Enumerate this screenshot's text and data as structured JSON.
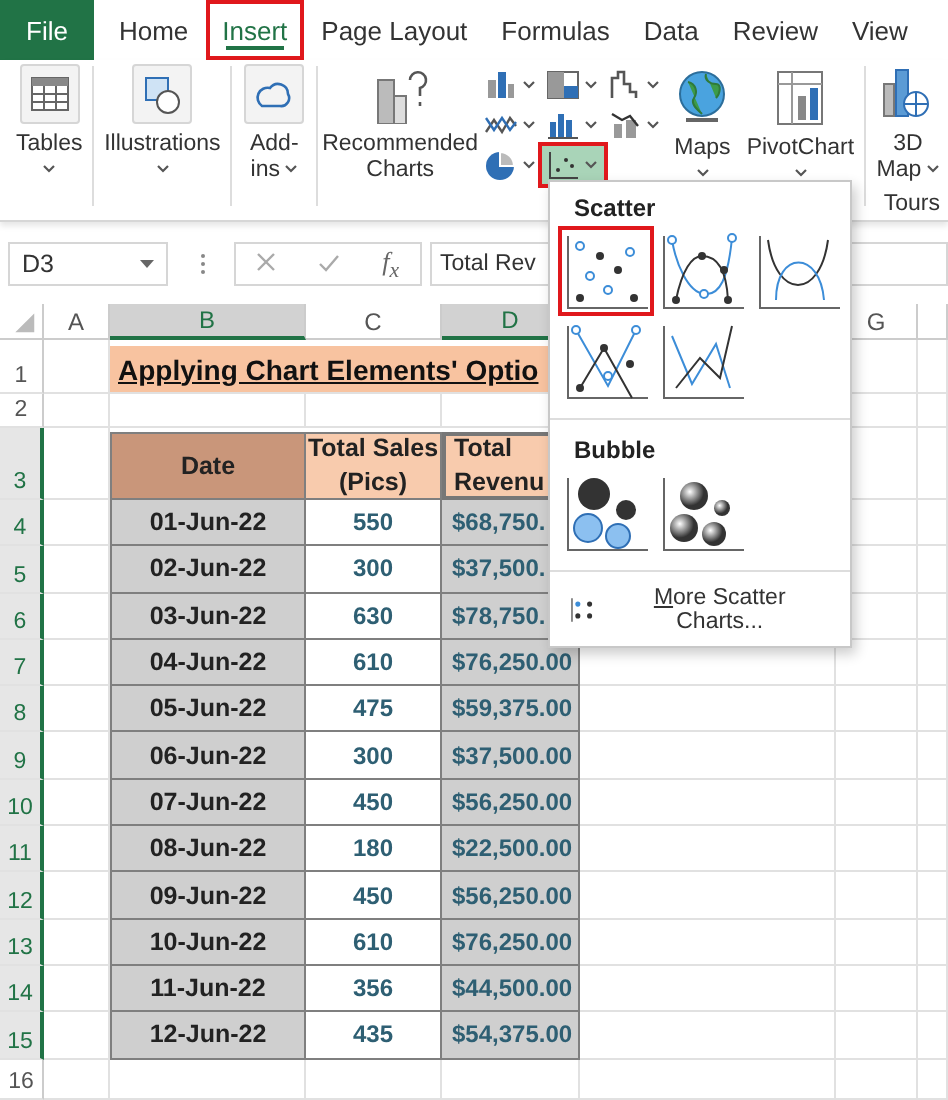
{
  "ribbon_tabs": [
    {
      "label": "File",
      "kind": "file",
      "selected": false,
      "highlighted": false
    },
    {
      "label": "Home",
      "kind": "tab",
      "selected": false,
      "highlighted": false
    },
    {
      "label": "Insert",
      "kind": "tab",
      "selected": true,
      "highlighted": true
    },
    {
      "label": "Page Layout",
      "kind": "tab",
      "selected": false,
      "highlighted": false
    },
    {
      "label": "Formulas",
      "kind": "tab",
      "selected": false,
      "highlighted": false
    },
    {
      "label": "Data",
      "kind": "tab",
      "selected": false,
      "highlighted": false
    },
    {
      "label": "Review",
      "kind": "tab",
      "selected": false,
      "highlighted": false
    },
    {
      "label": "View",
      "kind": "tab",
      "selected": false,
      "highlighted": false
    }
  ],
  "ribbon_buttons": [
    {
      "label": "Tables",
      "kind": "tables",
      "dropdown": true
    },
    {
      "label": "Illustrations",
      "kind": "illustrations",
      "dropdown": true
    },
    {
      "label": "Add-ins",
      "kind": "addins",
      "dropdown": true
    },
    {
      "label": "Recommended Charts",
      "kind": "recommended",
      "dropdown": false
    },
    {
      "kind": "chart_grid"
    },
    {
      "label": "Maps",
      "kind": "maps",
      "dropdown": true
    },
    {
      "label": "PivotChart",
      "kind": "pivot",
      "dropdown": true
    },
    {
      "label": "3D Map",
      "kind": "map3d",
      "dropdown": true
    }
  ],
  "chart_buttons": [
    {
      "kind": "column",
      "selected": false,
      "highlighted": false
    },
    {
      "kind": "hierarchy",
      "selected": false,
      "highlighted": false
    },
    {
      "kind": "waterfall",
      "selected": false,
      "highlighted": false
    },
    {
      "kind": "line",
      "selected": false,
      "highlighted": false
    },
    {
      "kind": "statistic",
      "selected": false,
      "highlighted": false
    },
    {
      "kind": "combo",
      "selected": false,
      "highlighted": false
    },
    {
      "kind": "pie",
      "selected": false,
      "highlighted": false
    },
    {
      "kind": "scatter",
      "selected": true,
      "highlighted": true
    }
  ],
  "group_labels": [
    "Tours"
  ],
  "formula_bar": {
    "name_box": "D3",
    "function_button": "f$_{x}$",
    "value": "Total Rev"
  },
  "columns": [
    {
      "label": "A",
      "selected": false
    },
    {
      "label": "B",
      "selected": true
    },
    {
      "label": "C",
      "selected": false
    },
    {
      "label": "D",
      "selected": true
    },
    {
      "label": "G",
      "selected": false
    }
  ],
  "row_headers": [
    {
      "label": "1",
      "selected": false
    },
    {
      "label": "2",
      "selected": false
    },
    {
      "label": "3",
      "selected": true
    },
    {
      "label": "4",
      "selected": true
    },
    {
      "label": "5",
      "selected": true
    },
    {
      "label": "6",
      "selected": true
    },
    {
      "label": "7",
      "selected": true
    },
    {
      "label": "8",
      "selected": true
    },
    {
      "label": "9",
      "selected": true
    },
    {
      "label": "10",
      "selected": true
    },
    {
      "label": "11",
      "selected": true
    },
    {
      "label": "12",
      "selected": true
    },
    {
      "label": "13",
      "selected": true
    },
    {
      "label": "14",
      "selected": true
    },
    {
      "label": "15",
      "selected": true
    },
    {
      "label": "16",
      "selected": false
    }
  ],
  "sheet": {
    "title": "Applying Chart Elements' Optio",
    "headers": [
      "Date",
      "Total Sales (Pics)",
      "Total Revenu"
    ],
    "rows": [
      {
        "date": "01-Jun-22",
        "sales": "550",
        "revenue": "$68,750."
      },
      {
        "date": "02-Jun-22",
        "sales": "300",
        "revenue": "$37,500."
      },
      {
        "date": "03-Jun-22",
        "sales": "630",
        "revenue": "$78,750."
      },
      {
        "date": "04-Jun-22",
        "sales": "610",
        "revenue": "$76,250.00"
      },
      {
        "date": "05-Jun-22",
        "sales": "475",
        "revenue": "$59,375.00"
      },
      {
        "date": "06-Jun-22",
        "sales": "300",
        "revenue": "$37,500.00"
      },
      {
        "date": "07-Jun-22",
        "sales": "450",
        "revenue": "$56,250.00"
      },
      {
        "date": "08-Jun-22",
        "sales": "180",
        "revenue": "$22,500.00"
      },
      {
        "date": "09-Jun-22",
        "sales": "450",
        "revenue": "$56,250.00"
      },
      {
        "date": "10-Jun-22",
        "sales": "610",
        "revenue": "$76,250.00"
      },
      {
        "date": "11-Jun-22",
        "sales": "356",
        "revenue": "$44,500.00"
      },
      {
        "date": "12-Jun-22",
        "sales": "435",
        "revenue": "$54,375.00"
      }
    ]
  },
  "scatter_menu": {
    "sections": [
      {
        "title": "Scatter",
        "charts": [
          {
            "kind": "markers",
            "highlighted": true
          },
          {
            "kind": "smooth_markers",
            "highlighted": false
          },
          {
            "kind": "smooth",
            "highlighted": false
          },
          {
            "kind": "straight_markers",
            "highlighted": false
          },
          {
            "kind": "straight",
            "highlighted": false
          }
        ]
      },
      {
        "title": "Bubble",
        "charts": [
          {
            "kind": "bubble",
            "highlighted": false
          },
          {
            "kind": "bubble_3d",
            "highlighted": false
          }
        ]
      }
    ],
    "more": "More Scatter Charts..."
  }
}
